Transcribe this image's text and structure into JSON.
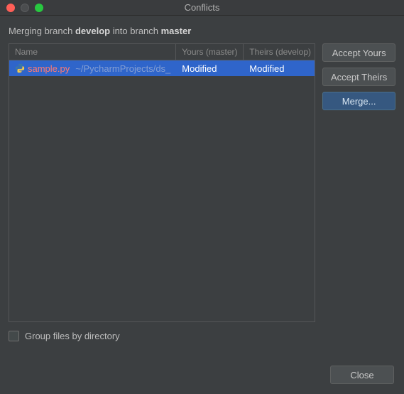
{
  "window": {
    "title": "Conflicts"
  },
  "message": {
    "prefix": "Merging branch ",
    "source_branch": "develop",
    "middle": " into branch ",
    "target_branch": "master"
  },
  "columns": {
    "name": "Name",
    "yours": "Yours (master)",
    "theirs": "Theirs (develop)"
  },
  "rows": [
    {
      "icon": "python-file-icon",
      "filename": "sample.py",
      "path": "~/PycharmProjects/ds_",
      "yours": "Modified",
      "theirs": "Modified"
    }
  ],
  "buttons": {
    "accept_yours": "Accept Yours",
    "accept_theirs": "Accept Theirs",
    "merge": "Merge...",
    "close": "Close"
  },
  "group_checkbox": {
    "label": "Group files by directory",
    "checked": false
  }
}
